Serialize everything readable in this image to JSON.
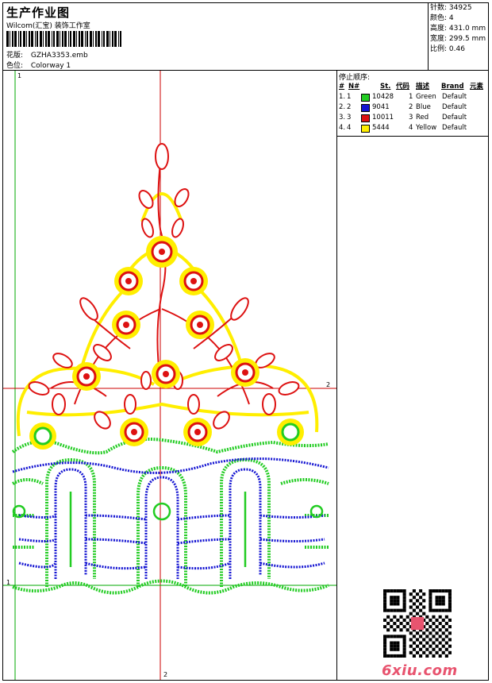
{
  "header": {
    "title": "生产作业图",
    "studio": "Wilcom(汇宝) 装饰工作室",
    "design_label": "花版:",
    "design_file": "GZHA3353.emb",
    "colorway_label": "色位:",
    "colorway_value": "Colorway 1"
  },
  "stats": [
    {
      "label": "针数:",
      "value": "34925"
    },
    {
      "label": "颜色:",
      "value": "4"
    },
    {
      "label": "高度:",
      "value": "431.0 mm"
    },
    {
      "label": "宽度:",
      "value": "299.5 mm"
    },
    {
      "label": "比例:",
      "value": "0.46"
    }
  ],
  "stop_sequence": {
    "title": "停止顺序:",
    "headers": [
      "#",
      "N#",
      "St.",
      "代码",
      "描述",
      "Brand",
      "元素"
    ],
    "rows": [
      {
        "idx": "1.",
        "n": "1",
        "swatch": "#22cc22",
        "stitches": "10428",
        "code": "1",
        "desc": "Green",
        "brand": "Default"
      },
      {
        "idx": "2.",
        "n": "2",
        "swatch": "#1414d2",
        "stitches": "9041",
        "code": "2",
        "desc": "Blue",
        "brand": "Default"
      },
      {
        "idx": "3.",
        "n": "3",
        "swatch": "#dd1111",
        "stitches": "10011",
        "code": "3",
        "desc": "Red",
        "brand": "Default"
      },
      {
        "idx": "4.",
        "n": "4",
        "swatch": "#ffee00",
        "stitches": "5444",
        "code": "4",
        "desc": "Yellow",
        "brand": "Default"
      }
    ]
  },
  "guides": {
    "v_top": "1",
    "h_right": "2",
    "h_left": "1",
    "v_bottom": "2"
  },
  "watermark": {
    "site": "6xiu.com"
  },
  "colors": {
    "green": "#22cc22",
    "blue": "#1414d2",
    "red": "#dd1111",
    "yellow": "#ffee00",
    "guide_red": "#cc0000",
    "guide_green": "#00aa00"
  }
}
